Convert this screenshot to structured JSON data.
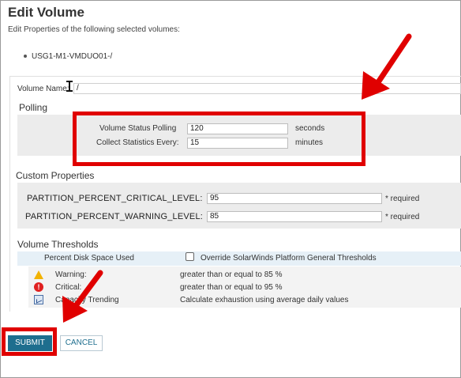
{
  "page": {
    "title": "Edit Volume",
    "subtitle": "Edit Properties of the following selected volumes:",
    "volume_item": "USG1-M1-VMDUO01-/"
  },
  "form": {
    "volume_name_label": "Volume Name:",
    "volume_name_value": "/"
  },
  "polling": {
    "section_title": "Polling",
    "status_label": "Volume Status Polling",
    "status_value": "120",
    "status_unit": "seconds",
    "stats_label": "Collect Statistics Every:",
    "stats_value": "15",
    "stats_unit": "minutes"
  },
  "custom_properties": {
    "section_title": "Custom Properties",
    "items": [
      {
        "label": "PARTITION_PERCENT_CRITICAL_LEVEL:",
        "value": "95",
        "required": "* required"
      },
      {
        "label": "PARTITION_PERCENT_WARNING_LEVEL:",
        "value": "85",
        "required": "* required"
      }
    ]
  },
  "thresholds": {
    "section_title": "Volume Thresholds",
    "metric_label": "Percent Disk Space Used",
    "override_label": "Override SolarWinds Platform General Thresholds",
    "override_checked": false,
    "rows": [
      {
        "icon": "warning-icon",
        "label": "Warning:",
        "value": "greater than or equal to 85 %"
      },
      {
        "icon": "critical-icon",
        "label": "Critical:",
        "value": "greater than or equal to 95 %"
      },
      {
        "icon": "capacity-trending-icon",
        "label": "Capacity Trending",
        "value": "Calculate exhaustion using average daily values"
      }
    ]
  },
  "buttons": {
    "submit": "SUBMIT",
    "cancel": "CANCEL"
  },
  "colors": {
    "annotation_red": "#e00000",
    "submit_bg": "#1e6e8e",
    "row_highlight": "#e6f0f7"
  }
}
